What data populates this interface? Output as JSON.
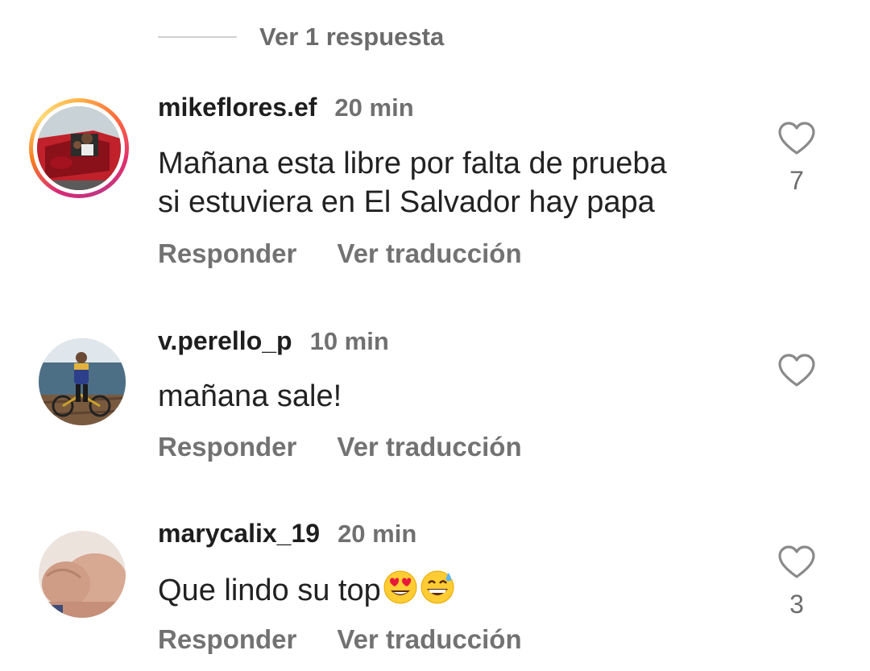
{
  "replies_link": {
    "label": "Ver 1 respuesta"
  },
  "comments": [
    {
      "username": "mikeflores.ef",
      "time": "20 min",
      "text_line1": "Mañana esta libre por falta de prueba",
      "text_line2": "si estuviera en El Salvador hay papa",
      "reply_label": "Responder",
      "translate_label": "Ver traducción",
      "likes": "7",
      "has_story_ring": true
    },
    {
      "username": "v.perello_p",
      "time": "10 min",
      "text": "mañana sale!",
      "reply_label": "Responder",
      "translate_label": "Ver traducción",
      "likes": ""
    },
    {
      "username": "marycalix_19",
      "time": "20 min",
      "text": "Que lindo su top",
      "emojis": [
        "smiling-face-with-heart-eyes",
        "grinning-face-with-sweat"
      ],
      "reply_label": "Responder",
      "translate_label": "Ver traducción",
      "likes": "3"
    }
  ],
  "colors": {
    "secondary_text": "#727272",
    "primary_text": "#1e1e1e",
    "story_ring": [
      "#feda75",
      "#fa7e1e",
      "#d62976",
      "#962fbf"
    ]
  },
  "icons": {
    "like": "heart-outline-icon"
  }
}
